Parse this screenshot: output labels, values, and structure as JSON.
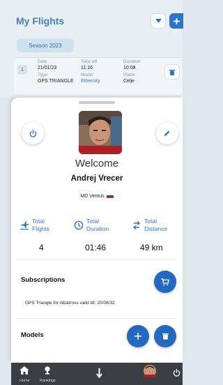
{
  "header": {
    "title": "My Flights"
  },
  "season": {
    "label": "Season 2023"
  },
  "flight": {
    "index": "1",
    "date_label": "Date",
    "date": "21/01/23",
    "takeoff_label": "Take-off",
    "takeoff": "11:16",
    "duration_label": "Duration",
    "duration": "10:08",
    "type_label": "Type",
    "type": "GPS TRIANGLE",
    "model_label": "Model",
    "model": "Ethernity",
    "place_label": "Place",
    "place": "Celje"
  },
  "profile": {
    "welcome": "Welcome",
    "name": "Andrej Vrecer",
    "glider": "MD Ventus"
  },
  "stats": {
    "flights_label_1": "Total",
    "flights_label_2": "Flights",
    "flights_value": "4",
    "duration_label_1": "Total",
    "duration_label_2": "Duration",
    "duration_value": "01:46",
    "distance_label_1": "Total",
    "distance_label_2": "Distance",
    "distance_value": "49 km"
  },
  "subscriptions": {
    "title": "Subscriptions",
    "item": "GPS Triangle for Albatross valid till: 20/08/32"
  },
  "models": {
    "title": "Models"
  },
  "nav": {
    "home": "Home",
    "rankings": "Rankings"
  },
  "colors": {
    "accent": "#2d73c9",
    "button": "#2468c0",
    "nav_bg": "#3a3d42"
  }
}
